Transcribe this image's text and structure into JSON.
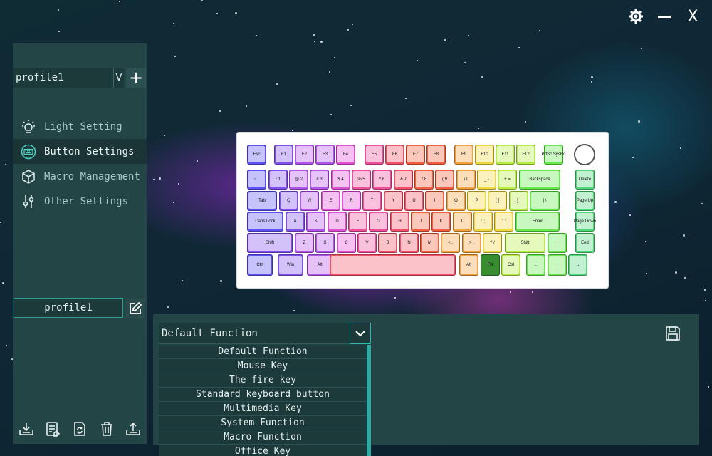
{
  "window": {
    "icons": [
      "gear-icon",
      "minimize-icon",
      "close-icon"
    ],
    "close_glyph": "X"
  },
  "sidebar": {
    "profile_select": {
      "value": "profile1",
      "dropdown_glyph": "V"
    },
    "add_glyph": "+",
    "items": [
      {
        "label": "Light Setting",
        "icon": "light-bulb-icon",
        "active": false
      },
      {
        "label": "Button Settings",
        "icon": "keyboard-icon",
        "active": true
      },
      {
        "label": "Macro Management",
        "icon": "cube-icon",
        "active": false
      },
      {
        "label": "Other Settings",
        "icon": "sliders-icon",
        "active": false
      }
    ],
    "profile_name": "profile1",
    "bottom_tools": [
      "import-icon",
      "export-list-icon",
      "refresh-icon",
      "trash-icon",
      "upload-icon"
    ]
  },
  "button_panel": {
    "function_select": {
      "value": "Default Function"
    },
    "options": [
      "Default Function",
      "Mouse Key",
      "The fire key",
      "Standard keyboard button",
      "Multimedia Key",
      "System Function",
      "Macro Function",
      "Office Key"
    ]
  },
  "keyboard": {
    "keys": [
      "Esc",
      "F1",
      "F2",
      "F3",
      "F4",
      "F5",
      "F6",
      "F7",
      "F8",
      "F9",
      "F10",
      "F11",
      "F12",
      "PrtSc SysRq",
      "~ `",
      "! 1",
      "@ 2",
      "# 3",
      "$ 4",
      "% 5",
      "^ 6",
      "& 7",
      "* 8",
      "( 9",
      ") 0",
      "_ -",
      "+ =",
      "Backspace",
      "Delete",
      "Tab",
      "Q",
      "W",
      "E",
      "R",
      "T",
      "Y",
      "U",
      "I",
      "O",
      "P",
      "{ [",
      "} ]",
      "| \\",
      "Page Up",
      "Caps Lock",
      "A",
      "S",
      "D",
      "F",
      "G",
      "H",
      "J",
      "K",
      "L",
      ": ;",
      "\" '",
      "Enter",
      "Page Down",
      "Shift",
      "Z",
      "X",
      "C",
      "V",
      "B",
      "N",
      "M",
      "< ,",
      "> .",
      "? /",
      "Shift",
      "↑",
      "End",
      "Ctrl",
      "Win",
      "Alt",
      "",
      "Alt",
      "FN",
      "Ctrl",
      "←",
      "↓",
      "→"
    ]
  }
}
